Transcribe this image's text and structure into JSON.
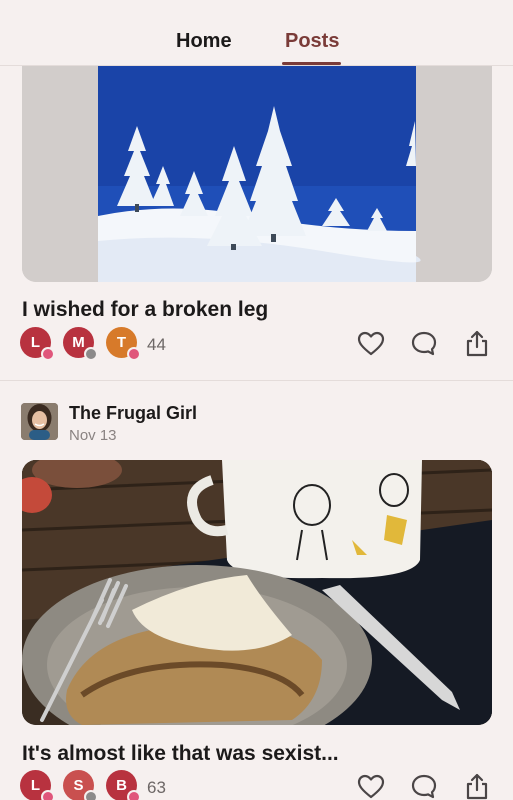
{
  "tabs": {
    "home_label": "Home",
    "posts_label": "Posts",
    "active": "Posts"
  },
  "colors": {
    "accent": "#7a3b38",
    "background": "#f6f0ef",
    "heart_badge": "#e0567b"
  },
  "posts": [
    {
      "title": "I wished for a broken leg",
      "image_icon": "snowy-trees-photo",
      "reactions": {
        "avatars": [
          {
            "initial": "L",
            "color": "#b8323f",
            "badge": "heart"
          },
          {
            "initial": "M",
            "color": "#b8323f",
            "badge": "comment"
          },
          {
            "initial": "T",
            "color": "#d77a2a",
            "badge": "heart"
          }
        ],
        "count": "44"
      }
    },
    {
      "author": {
        "name": "The Frugal Girl",
        "date": "Nov 13"
      },
      "title": "It's almost like that was sexist...",
      "image_icon": "crepe-and-snoopy-mug-photo",
      "reactions": {
        "avatars": [
          {
            "initial": "L",
            "color": "#b8323f",
            "badge": "heart"
          },
          {
            "initial": "S",
            "color": "#c9504f",
            "badge": "comment"
          },
          {
            "initial": "B",
            "color": "#b8323f",
            "badge": "heart"
          }
        ],
        "count": "63"
      }
    }
  ],
  "actions": [
    "like-icon",
    "comment-icon",
    "share-icon"
  ]
}
